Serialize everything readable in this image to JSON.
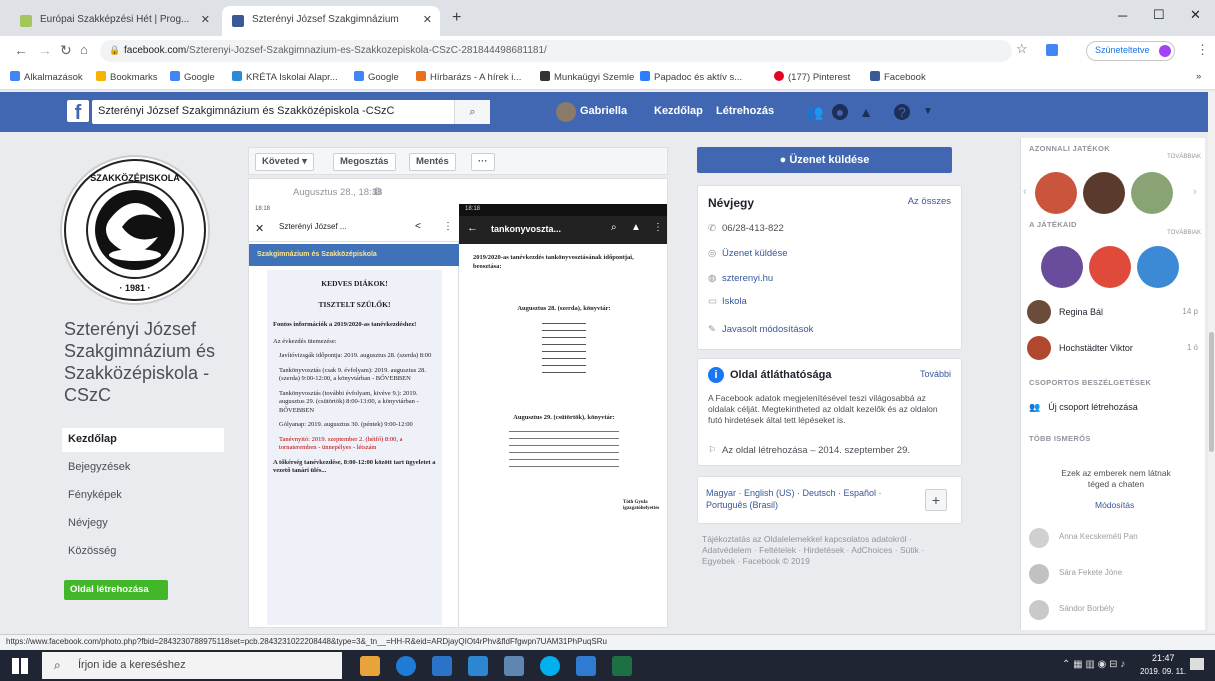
{
  "browser": {
    "tabs": [
      {
        "title": "Európai Szakképzési Hét | Prog..."
      },
      {
        "title": "Szterényi József Szakgimnázium"
      }
    ],
    "url_domain": "facebook.com",
    "url_path": "/Szterenyi-Jozsef-Szakgimnazium-es-Szakkozepiskola-CSzC-281844498681181/",
    "profile": "Szüneteltetve",
    "bookmarks": [
      {
        "label": "Alkalmazások",
        "color": "#4285f4"
      },
      {
        "label": "Bookmarks",
        "color": "#f4b400"
      },
      {
        "label": "Google",
        "color": "#4285f4"
      },
      {
        "label": "KRÉTA Iskolai Alapr...",
        "color": "#2a8bd6"
      },
      {
        "label": "Google",
        "color": "#4285f4"
      },
      {
        "label": "Hírbarázs - A hírek i...",
        "color": "#e8711a"
      },
      {
        "label": "Munkaügyi Szemle",
        "color": "#333"
      },
      {
        "label": "Papadoc és aktív s...",
        "color": "#2a7fff"
      },
      {
        "label": "(177) Pinterest",
        "color": "#e60023"
      },
      {
        "label": "Facebook",
        "color": "#3b5998"
      }
    ]
  },
  "fb": {
    "search_value": "Szterényi József Szakgimnázium és Szakközépiskola -CSzC",
    "user": "Gabriella",
    "nav_home": "Kezdőlap",
    "nav_create": "Létrehozás"
  },
  "page": {
    "name": "Szterényi József Szakgimnázium és Szakközépiskola - CSzC",
    "nav": [
      "Kezdőlap",
      "Bejegyzések",
      "Fényképek",
      "Névjegy",
      "Közösség"
    ],
    "create_page": "Oldal létrehozása"
  },
  "post": {
    "actions": {
      "follow": "Követed ▾",
      "share": "Megosztás",
      "save": "Mentés",
      "more": "···"
    },
    "date": "Augusztus 28., 18:38",
    "phone1": {
      "time": "18:18",
      "title": "Szterényi József ...",
      "banner": "Szakgimnázium és Szakközépiskola",
      "greeting1": "KEDVES DIÁKOK!",
      "greeting2": "TISZTELT SZÜLŐK!",
      "heading": "Fontos információk a 2019/2020-as tanévkezdéshez!",
      "intro": "Az évkezdés ütemezése:",
      "items": [
        "Javítóvizsgák időpontja: 2019. augusztus 28. (szerda) 8:00",
        "Tankönyvosztás (csak 9. évfolyam): 2019. augusztus 28. (szerda) 9:00-12:00, a könyvtárban - BŐVEBBEN",
        "Tankönyvosztás (további évfolyam, kivéve 9.): 2019. augusztus 29. (csütörtök) 8:00-13:00, a könyvtárban - BŐVEBBEN",
        "Gólyanap: 2019. augusztus 30. (péntek) 9:00-12:00",
        "Tanévnyitó: 2019. szeptember 2. (hétfő) 8:00, a tornateremben - ünnepélyes - létszám"
      ],
      "footer": "A tőkérség tanévkezdése, 8:00-12:00 között tart ügyeletet a vezető tanári ülés..."
    },
    "phone2": {
      "time": "18:18",
      "title": "tankonyvoszta...",
      "heading": "2019/2020-as tanévkezdés tankönyvosztásának időpontjai, beosztása:",
      "day1": "Augusztus 28. (szerda), könyvtár:",
      "day2": "Augusztus 29. (csütörtök), könyvtár:",
      "sign": "Tóth Gyula igazgatóhelyettes"
    }
  },
  "sidebar": {
    "send_message": "Üzenet küldése",
    "about_title": "Névjegy",
    "about_all": "Az összes",
    "phone": "06/28-413-822",
    "message": "Üzenet küldése",
    "website": "szterenyi.hu",
    "category": "Iskola",
    "suggest": "Javasolt módosítások",
    "transparency_title": "Oldal átláthatósága",
    "transparency_more": "További",
    "transparency_text": "A Facebook adatok megjelenítésével teszi világosabbá az oldalak célját. Megtekintheted az oldalt kezelők és az oldalon futó hirdetések által tett lépéseket is.",
    "created": "Az oldal létrehozása – 2014. szeptember 29.",
    "languages": "Magyar · English (US) · Deutsch · Español · Português (Brasil)",
    "footer": "Tájékoztatás az Oldalelemekkel kapcsolatos adatokról · Adatvédelem · Feltételek · Hirdetések · AdChoices · Sütik · Egyebek · Facebook © 2019"
  },
  "chat": {
    "games_title": "AZONNALI JATÉKOK",
    "more": "TOVÁBBIAK",
    "my_games": "A JÁTÉKAID",
    "contacts": [
      {
        "name": "Regina Bál",
        "time": "14 p"
      },
      {
        "name": "Hochstädter Viktor",
        "time": "1 ó"
      }
    ],
    "groups_title": "CSOPORTOS BESZÉLGETÉSEK",
    "new_group": "Új csoport létrehozása",
    "more_contacts": "TÖBB ISMERŐS",
    "offline_text": "Ezek az emberek nem látnak téged a chaten",
    "offline_link": "Módosítás",
    "offline": [
      "Anna Kecskeméti Pan",
      "Sára Fekete Jóne",
      "Sándor Borbély"
    ]
  },
  "statusbar": {
    "url": "https://www.facebook.com/photo.php?fbid=2843230788975118set=pcb.2843231022208448&type=3&_tn__=HH-R&eid=ARDjayQIOt4rPhv&fldFfgwpn7UAM31PhPuqSRu"
  },
  "taskbar": {
    "search_placeholder": "Írjon ide a kereséshez",
    "time": "21:47",
    "date": "2019. 09. 11."
  }
}
